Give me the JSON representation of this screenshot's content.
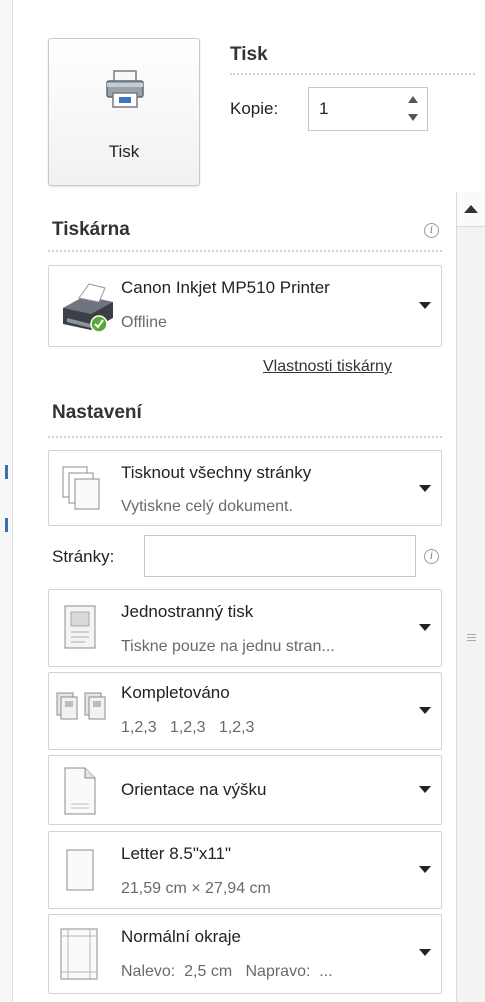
{
  "print": {
    "button_label": "Tisk",
    "section_title": "Tisk",
    "copies_label": "Kopie:",
    "copies_value": "1"
  },
  "printer": {
    "section_title": "Tiskárna",
    "name": "Canon Inkjet MP510 Printer",
    "status": "Offline",
    "properties_link": "Vlastnosti tiskárny"
  },
  "settings": {
    "section_title": "Nastavení",
    "pages_label": "Stránky:",
    "pages_value": "",
    "items": [
      {
        "title": "Tisknout všechny stránky",
        "subtitle": "Vytiskne celý dokument."
      },
      {
        "title": "Jednostranný tisk",
        "subtitle": "Tiskne pouze na jednu stran..."
      },
      {
        "title": "Kompletováno",
        "subtitle": "1,2,3   1,2,3   1,2,3"
      },
      {
        "title": "Orientace na výšku",
        "subtitle": ""
      },
      {
        "title": "Letter 8.5\"x11\"",
        "subtitle": "21,59 cm × 27,94 cm"
      },
      {
        "title": "Normální okraje",
        "subtitle": "Nalevo:  2,5 cm   Napravo:  ..."
      }
    ]
  },
  "icons": [
    "printer-icon",
    "info-icon",
    "pages-icon",
    "single-sided-icon",
    "collated-icon",
    "portrait-icon",
    "paper-size-icon",
    "margins-icon",
    "scroll-up-icon",
    "dropdown-arrow-icon"
  ],
  "colors": {
    "accent": "#3a6db5",
    "border": "#d4d4d4",
    "background": "#ffffff"
  }
}
